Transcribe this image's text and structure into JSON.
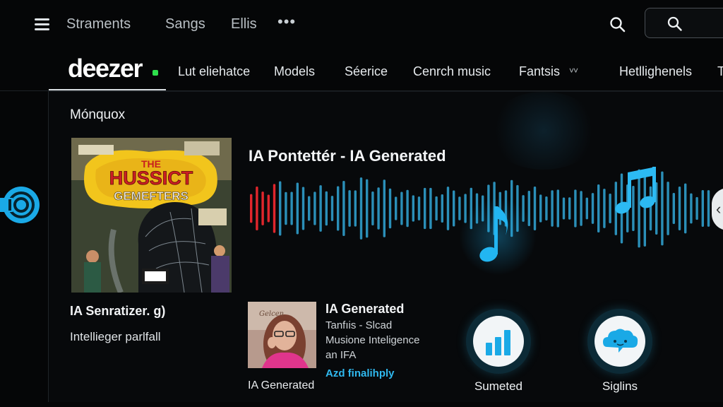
{
  "topbar": {
    "links": [
      "Straments",
      "Sangs",
      "Ellis"
    ],
    "more_label": "•••",
    "search_placeholder": ""
  },
  "navbar": {
    "logo": "deezer",
    "items": [
      "Lut eliehatce",
      "Models",
      "Séerice",
      "Cenrch music",
      "Fantsis",
      "Hetllighenels",
      "T"
    ]
  },
  "section": {
    "title": "Mónquox"
  },
  "album": {
    "cover_text_1": "THE",
    "cover_text_2": "HUSSICT",
    "cover_text_3": "GEMEFTERS",
    "title": "IA Senratizer. g)",
    "subtitle": "Intelliege​r parlfall"
  },
  "player": {
    "title": "IA Pontettér - IA Generated"
  },
  "track": {
    "thumb_label": "IA Generated",
    "title": "IA Generated",
    "lines": [
      "Tanfıis - Slcad",
      "Musione Inteligence",
      "an IFA"
    ],
    "link": "Azd finalihply"
  },
  "shortcuts": [
    {
      "label": "Sumeted",
      "icon": "bar-chart-icon"
    },
    {
      "label": "Siglins",
      "icon": "chat-cloud-icon"
    }
  ],
  "colors": {
    "accent": "#2fb8ee",
    "wave_red": "#e0262c",
    "wave_blue": "#2b8fb8",
    "logo_dot": "#2ee04c",
    "background": "#050607"
  }
}
